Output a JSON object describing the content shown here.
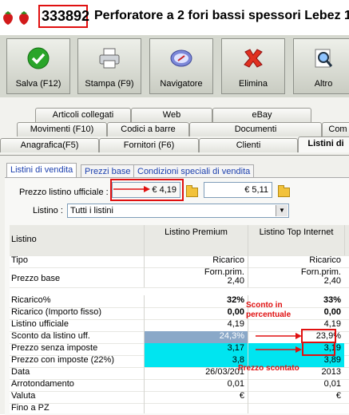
{
  "header": {
    "code": "333892",
    "title": "Perforatore a 2 fori bassi spessori Lebez 1"
  },
  "toolbar": [
    {
      "label": "Salva (F12)",
      "icon": "check-icon"
    },
    {
      "label": "Stampa (F9)",
      "icon": "printer-icon"
    },
    {
      "label": "Navigatore",
      "icon": "compass-icon"
    },
    {
      "label": "Elimina",
      "icon": "delete-x-icon"
    },
    {
      "label": "Altro",
      "icon": "search-icon"
    }
  ],
  "tabs_row1": [
    "Articoli collegati",
    "Web",
    "eBay"
  ],
  "tabs_row2": [
    "Movimenti (F10)",
    "Codici a barre",
    "Documenti",
    "Com"
  ],
  "tabs_row3": [
    "Anagrafica(F5)",
    "Fornitori (F6)",
    "Clienti",
    "Listini di"
  ],
  "subtabs": [
    "Listini di vendita",
    "Prezzi base",
    "Condizioni speciali di vendita"
  ],
  "form": {
    "prezzo_label": "Prezzo listino ufficiale :",
    "prezzo_1": "€ 4,19",
    "prezzo_2": "€ 5,11",
    "listino_label": "Listino :",
    "listino_value": "Tutti i listini"
  },
  "grid": {
    "headers": [
      "Listino",
      "Listino Premium",
      "Listino Top Internet"
    ],
    "rows": [
      {
        "label": "Tipo",
        "v1": "Ricarico",
        "v2": "Ricarico"
      },
      {
        "label": "Prezzo base",
        "v1a": "Forn.prim.",
        "v1": "2,40",
        "v2a": "Forn.prim.",
        "v2": "2,40"
      },
      {
        "label": "Ricarico%",
        "v1": "32%",
        "v2": "33%"
      },
      {
        "label": "Ricarico (Importo fisso)",
        "v1": "0,00",
        "v2": "0,00"
      },
      {
        "label": "Listino ufficiale",
        "v1": "4,19",
        "v2": "4,19"
      },
      {
        "label": "Sconto da listino uff.",
        "v1": "24,3%",
        "v2": "23,9%"
      },
      {
        "label": "Prezzo senza imposte",
        "v1": "3,17",
        "v2": "3,19"
      },
      {
        "label": "Prezzo con imposte (22%)",
        "v1": "3,8",
        "v2": "3,89"
      },
      {
        "label": "Data",
        "v1": "26/03/201",
        "v2": "2013"
      },
      {
        "label": "Arrotondamento",
        "v1": "0,01",
        "v2": "0,01"
      },
      {
        "label": "Valuta",
        "v1": "€",
        "v2": "€"
      },
      {
        "label": "Fino a PZ",
        "v1": "",
        "v2": ""
      }
    ]
  },
  "annotations": {
    "sconto": "Sconto in percentuale",
    "prezzo": "Prezzo scontato"
  },
  "colors": {
    "highlight_red": "#e01010",
    "row_cyan": "#00e5f0",
    "row_blue": "#8aa8c8"
  }
}
